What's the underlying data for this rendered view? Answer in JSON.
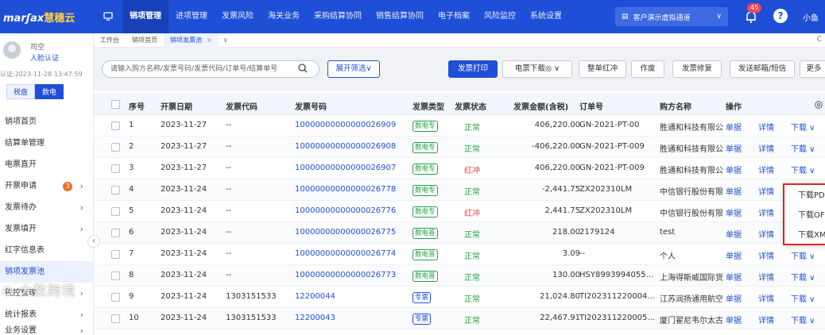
{
  "header": {
    "logo_latin": "marʃax",
    "logo_cn": "慧穗云",
    "nav": [
      "销项管理",
      "进项管理",
      "发票风险",
      "海关业务",
      "采购结算协同",
      "销售结算协同",
      "电子档案",
      "风险监控",
      "系统设置"
    ],
    "active_nav": 0,
    "company": "客户演示虚拟通道",
    "notifications": "45",
    "help": "?",
    "user": "小鱼"
  },
  "sidebar": {
    "user_title": "司空",
    "cert_label": "人脸认证",
    "cert_date": "认证:2023-11-28 13:47:59",
    "tags": [
      "税盘",
      "数电"
    ],
    "active_tag": 1,
    "items": [
      {
        "label": "销项首页",
        "arrow": ""
      },
      {
        "label": "结算单管理",
        "arrow": ""
      },
      {
        "label": "电票直开",
        "arrow": ""
      },
      {
        "label": "开票申请",
        "arrow": "›",
        "badge": "3"
      },
      {
        "label": "发票待办",
        "arrow": "›"
      },
      {
        "label": "发票填开",
        "arrow": "›"
      },
      {
        "label": "红字信息表",
        "arrow": ""
      },
      {
        "label": "销项发票池",
        "arrow": ""
      },
      {
        "label": "税控管理",
        "arrow": "›"
      },
      {
        "label": "统计报表",
        "arrow": "›"
      },
      {
        "label": "业务设置",
        "arrow": "›"
      }
    ],
    "active_item": 7,
    "collapse": "‹",
    "watermark": "大数跨境"
  },
  "tabs": {
    "items": [
      "工作台",
      "销项首页",
      "销项发票池"
    ],
    "active": 2,
    "close": "×",
    "more": "∨",
    "refresh": "C"
  },
  "toolbar": {
    "search_placeholder": "请输入购方名称/发票号码/发票代码/订单号/结算单号",
    "filter": "展开筛选∨",
    "print": "发票打印",
    "download": "电票下载◎ ∨",
    "red_all": "整单红冲",
    "void": "作废",
    "repair": "发票修复",
    "send": "发送邮箱/短信",
    "more": "更多"
  },
  "table": {
    "columns": [
      "序号",
      "开票日期",
      "发票代码",
      "发票号码",
      "发票类型",
      "发票状态",
      "发票金额(含税)",
      "订单号",
      "购方名称",
      "操作"
    ],
    "rows": [
      {
        "no": "1",
        "date": "2023-11-27",
        "code": "--",
        "number": "10000000000000026909",
        "type": "数电专",
        "status": "正常",
        "amount": "406,220.00",
        "order": "GN-2021-PT-00",
        "buyer": "胜通和科技有限公",
        "op1": "单据",
        "op2": "详情",
        "op3": "下载 ∨"
      },
      {
        "no": "2",
        "date": "2023-11-27",
        "code": "--",
        "number": "10000000000000026908",
        "type": "数电专",
        "status": "正常",
        "amount": "-406,220.00",
        "order": "GN-2021-PT-009",
        "buyer": "胜通和科技有限公",
        "op1": "单据",
        "op2": "详情",
        "op3": "下载 ∨"
      },
      {
        "no": "3",
        "date": "2023-11-27",
        "code": "--",
        "number": "10000000000000026907",
        "type": "数电专",
        "status": "红冲",
        "amount": "406,220.00",
        "order": "GN-2021-PT-009",
        "buyer": "胜通和科技有限公",
        "op1": "单据",
        "op2": "详情",
        "op3": "下载 ∨"
      },
      {
        "no": "4",
        "date": "2023-11-24",
        "code": "--",
        "number": "10000000000000026778",
        "type": "数电专",
        "status": "正常",
        "amount": "-2,441.75",
        "order": "ZX202310LM",
        "buyer": "中信银行股份有限",
        "op1": "单据",
        "op2": "详情",
        "op3": ""
      },
      {
        "no": "5",
        "date": "2023-11-24",
        "code": "--",
        "number": "10000000000000026776",
        "type": "数电专",
        "status": "红冲",
        "amount": "2,441.75",
        "order": "ZX202310LM",
        "buyer": "中信银行股份有限",
        "op1": "单据",
        "op2": "详情",
        "op3": ""
      },
      {
        "no": "6",
        "date": "2023-11-24",
        "code": "--",
        "number": "10000000000000026775",
        "type": "数电普",
        "status": "正常",
        "amount": "218.00",
        "order": "2179124",
        "buyer": "test",
        "op1": "单据",
        "op2": "详情",
        "op3": ""
      },
      {
        "no": "7",
        "date": "2023-11-24",
        "code": "--",
        "number": "10000000000000026774",
        "type": "数电普",
        "status": "正常",
        "amount": "3.09",
        "order": "--",
        "buyer": "个人",
        "op1": "单据",
        "op2": "详情",
        "op3": "下载 ∨"
      },
      {
        "no": "8",
        "date": "2023-11-24",
        "code": "--",
        "number": "10000000000000026773",
        "type": "数电普",
        "status": "正常",
        "amount": "130.00",
        "order": "HSY8993994055...",
        "buyer": "上海得斯威国际货",
        "op1": "单据",
        "op2": "详情",
        "op3": "下载 ∨"
      },
      {
        "no": "9",
        "date": "2023-11-24",
        "code": "1303151533",
        "number": "12200044",
        "type": "专票",
        "status": "正常",
        "amount": "21,024.80",
        "order": "TI202311220004...",
        "buyer": "江苏润扬通用航空",
        "op1": "单据",
        "op2": "详情",
        "op3": "下载 ∨"
      },
      {
        "no": "10",
        "date": "2023-11-24",
        "code": "1303151533",
        "number": "12200043",
        "type": "专票",
        "status": "正常",
        "amount": "22,467.91",
        "order": "TI202311220005...",
        "buyer": "厦门翟尼韦尔太古",
        "op1": "单据",
        "op2": "详情",
        "op3": "下载 ∨"
      }
    ]
  },
  "download_menu": [
    "下载PDF",
    "下载OFD",
    "下载XML"
  ],
  "colors": {
    "primary": "#1f4fd6",
    "ok": "#25a244",
    "red": "#f03c3c",
    "highlight": "#e02424"
  }
}
